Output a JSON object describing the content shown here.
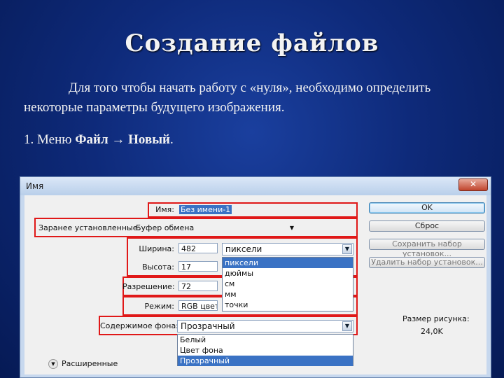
{
  "slide": {
    "title": "Создание файлов",
    "paragraph": "Для того чтобы  начать работу с «нуля», необходимо определить некоторые параметры будущего изображения.",
    "menu_prefix": "1. Меню ",
    "menu_file": "Файл",
    "menu_arrow": "→",
    "menu_new": "Новый",
    "menu_end": "."
  },
  "dialog": {
    "title": "Имя",
    "close": "✕",
    "name_label": "Имя:",
    "name_value": "Без имени-1",
    "preset_label": "Заранее установленные:",
    "preset_value": "Буфер обмена",
    "width_label": "Ширина:",
    "width_value": "482",
    "height_label": "Высота:",
    "height_value": "17",
    "resolution_label": "Разрешение:",
    "resolution_value": "72",
    "mode_label": "Режим:",
    "mode_value": "RGB цвет",
    "contents_label": "Содержимое фона:",
    "contents_value": "Прозрачный",
    "units_value": "пиксели",
    "units_options": [
      "пиксели",
      "дюймы",
      "см",
      "мм",
      "точки"
    ],
    "contents_options": [
      "Белый",
      "Цвет фона",
      "Прозрачный"
    ],
    "ok": "OK",
    "cancel": "Сброс",
    "save_preset": "Сохранить набор установок...",
    "delete_preset": "Удалить набор установок...",
    "image_size_label": "Размер рисунка:",
    "image_size_value": "24,0K",
    "advanced": "Расширенные",
    "advanced_icon": "chevron-down-icon",
    "accent_color": "#3a72c4",
    "highlight_color": "#e01818"
  }
}
